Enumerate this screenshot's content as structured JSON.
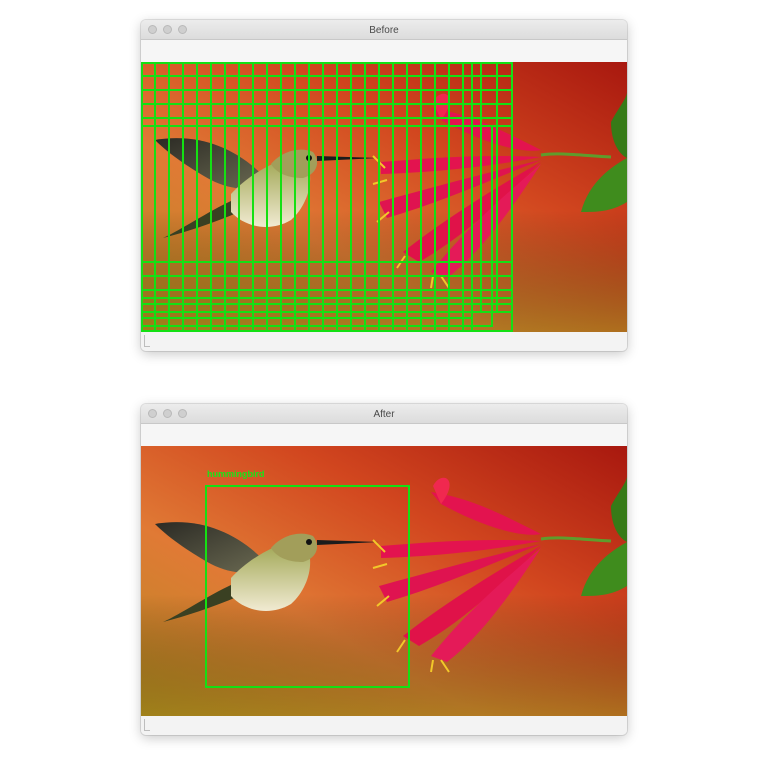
{
  "windows": {
    "before": {
      "title": "Before"
    },
    "after": {
      "title": "After"
    }
  },
  "detection": {
    "label": "hummingbird",
    "box_color": "#14e014"
  },
  "colors": {
    "background_dark_red": "#b3221a",
    "background_orange": "#e0722f",
    "background_olive": "#9c8a1d",
    "flower_red": "#e3134f",
    "leaf_green": "#3e8c1e"
  }
}
